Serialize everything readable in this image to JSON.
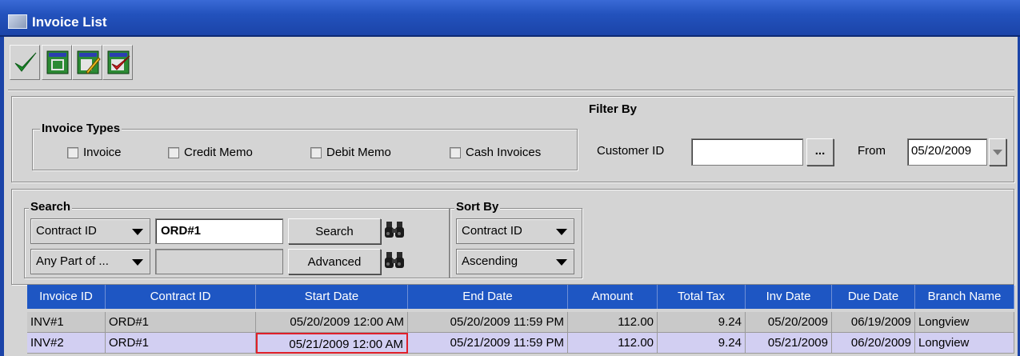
{
  "window": {
    "title": "Invoice List"
  },
  "toolbar": {
    "buttons": [
      {
        "name": "ok",
        "icon": "green-check-icon"
      },
      {
        "name": "invoice",
        "icon": "invoice-icon"
      },
      {
        "name": "edit-invoice",
        "icon": "invoice-edit-icon"
      },
      {
        "name": "approve-invoice",
        "icon": "invoice-approve-icon"
      }
    ]
  },
  "filter": {
    "title": "Filter By",
    "invoice_types": {
      "title": "Invoice Types",
      "options": [
        "Invoice",
        "Credit Memo",
        "Debit Memo",
        "Cash Invoices"
      ]
    },
    "customer_id_label": "Customer ID",
    "customer_id_value": "",
    "browse_label": "...",
    "from_label": "From",
    "from_value": "05/20/2009"
  },
  "search": {
    "title": "Search",
    "field_select": "Contract ID",
    "query_value": "ORD#1",
    "match_select": "Any Part of ...",
    "query2_value": "",
    "search_button": "Search",
    "advanced_button": "Advanced"
  },
  "sort": {
    "title": "Sort By",
    "field_select": "Contract ID",
    "order_select": "Ascending"
  },
  "table": {
    "columns": [
      "Invoice ID",
      "Contract ID",
      "Start Date",
      "End Date",
      "Amount",
      "Total Tax",
      "Inv Date",
      "Due Date",
      "Branch Name"
    ],
    "rows": [
      [
        "INV#1",
        "ORD#1",
        "05/20/2009 12:00 AM",
        "05/20/2009 11:59 PM",
        "112.00",
        "9.24",
        "05/20/2009",
        "06/19/2009",
        "Longview"
      ],
      [
        "INV#2",
        "ORD#1",
        "05/21/2009 12:00 AM",
        "05/21/2009 11:59 PM",
        "112.00",
        "9.24",
        "05/21/2009",
        "06/20/2009",
        "Longview"
      ]
    ]
  },
  "colors": {
    "titlebar": "#2352bd",
    "header": "#1e56c3",
    "selected_row": "#d2cff2",
    "focus_border": "#e0202a"
  }
}
